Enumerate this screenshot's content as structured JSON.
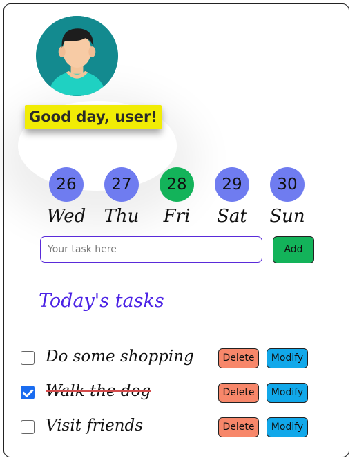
{
  "greeting": "Good day, user!",
  "days": [
    {
      "num": "26",
      "name": "Wed",
      "active": false
    },
    {
      "num": "27",
      "name": "Thu",
      "active": false
    },
    {
      "num": "28",
      "name": "Fri",
      "active": true
    },
    {
      "num": "29",
      "name": "Sat",
      "active": false
    },
    {
      "num": "30",
      "name": "Sun",
      "active": false
    }
  ],
  "input": {
    "placeholder": "Your task here",
    "value": ""
  },
  "add_label": "Add",
  "section_title": "Today's tasks",
  "tasks": [
    {
      "text": "Do some shopping",
      "done": false,
      "delete_label": "Delete",
      "modify_label": "Modify"
    },
    {
      "text": "Walk the dog",
      "done": true,
      "delete_label": "Delete",
      "modify_label": "Modify"
    },
    {
      "text": "Visit friends",
      "done": false,
      "delete_label": "Delete",
      "modify_label": "Modify"
    }
  ],
  "colors": {
    "day_default": "#6f7cf0",
    "day_active": "#13b35a",
    "greeting_bg": "#f1ec05",
    "title": "#4b22e5",
    "delete_bg": "#f7876a",
    "modify_bg": "#11a8ea",
    "add_bg": "#13b35a"
  }
}
